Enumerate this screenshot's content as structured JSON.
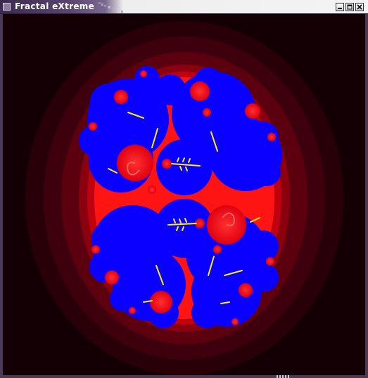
{
  "window": {
    "title": "Fractal eXtreme"
  },
  "colors": {
    "background": "#140004",
    "glow_inner": "#ff1a1a",
    "glow_outer": "#2a0008",
    "set_fill": "#0a00ff",
    "filament": "#ffee00"
  },
  "icons": {
    "window_menu": "window-menu-icon",
    "minimize": "minimize-icon",
    "maximize": "maximize-icon",
    "close": "close-icon"
  }
}
